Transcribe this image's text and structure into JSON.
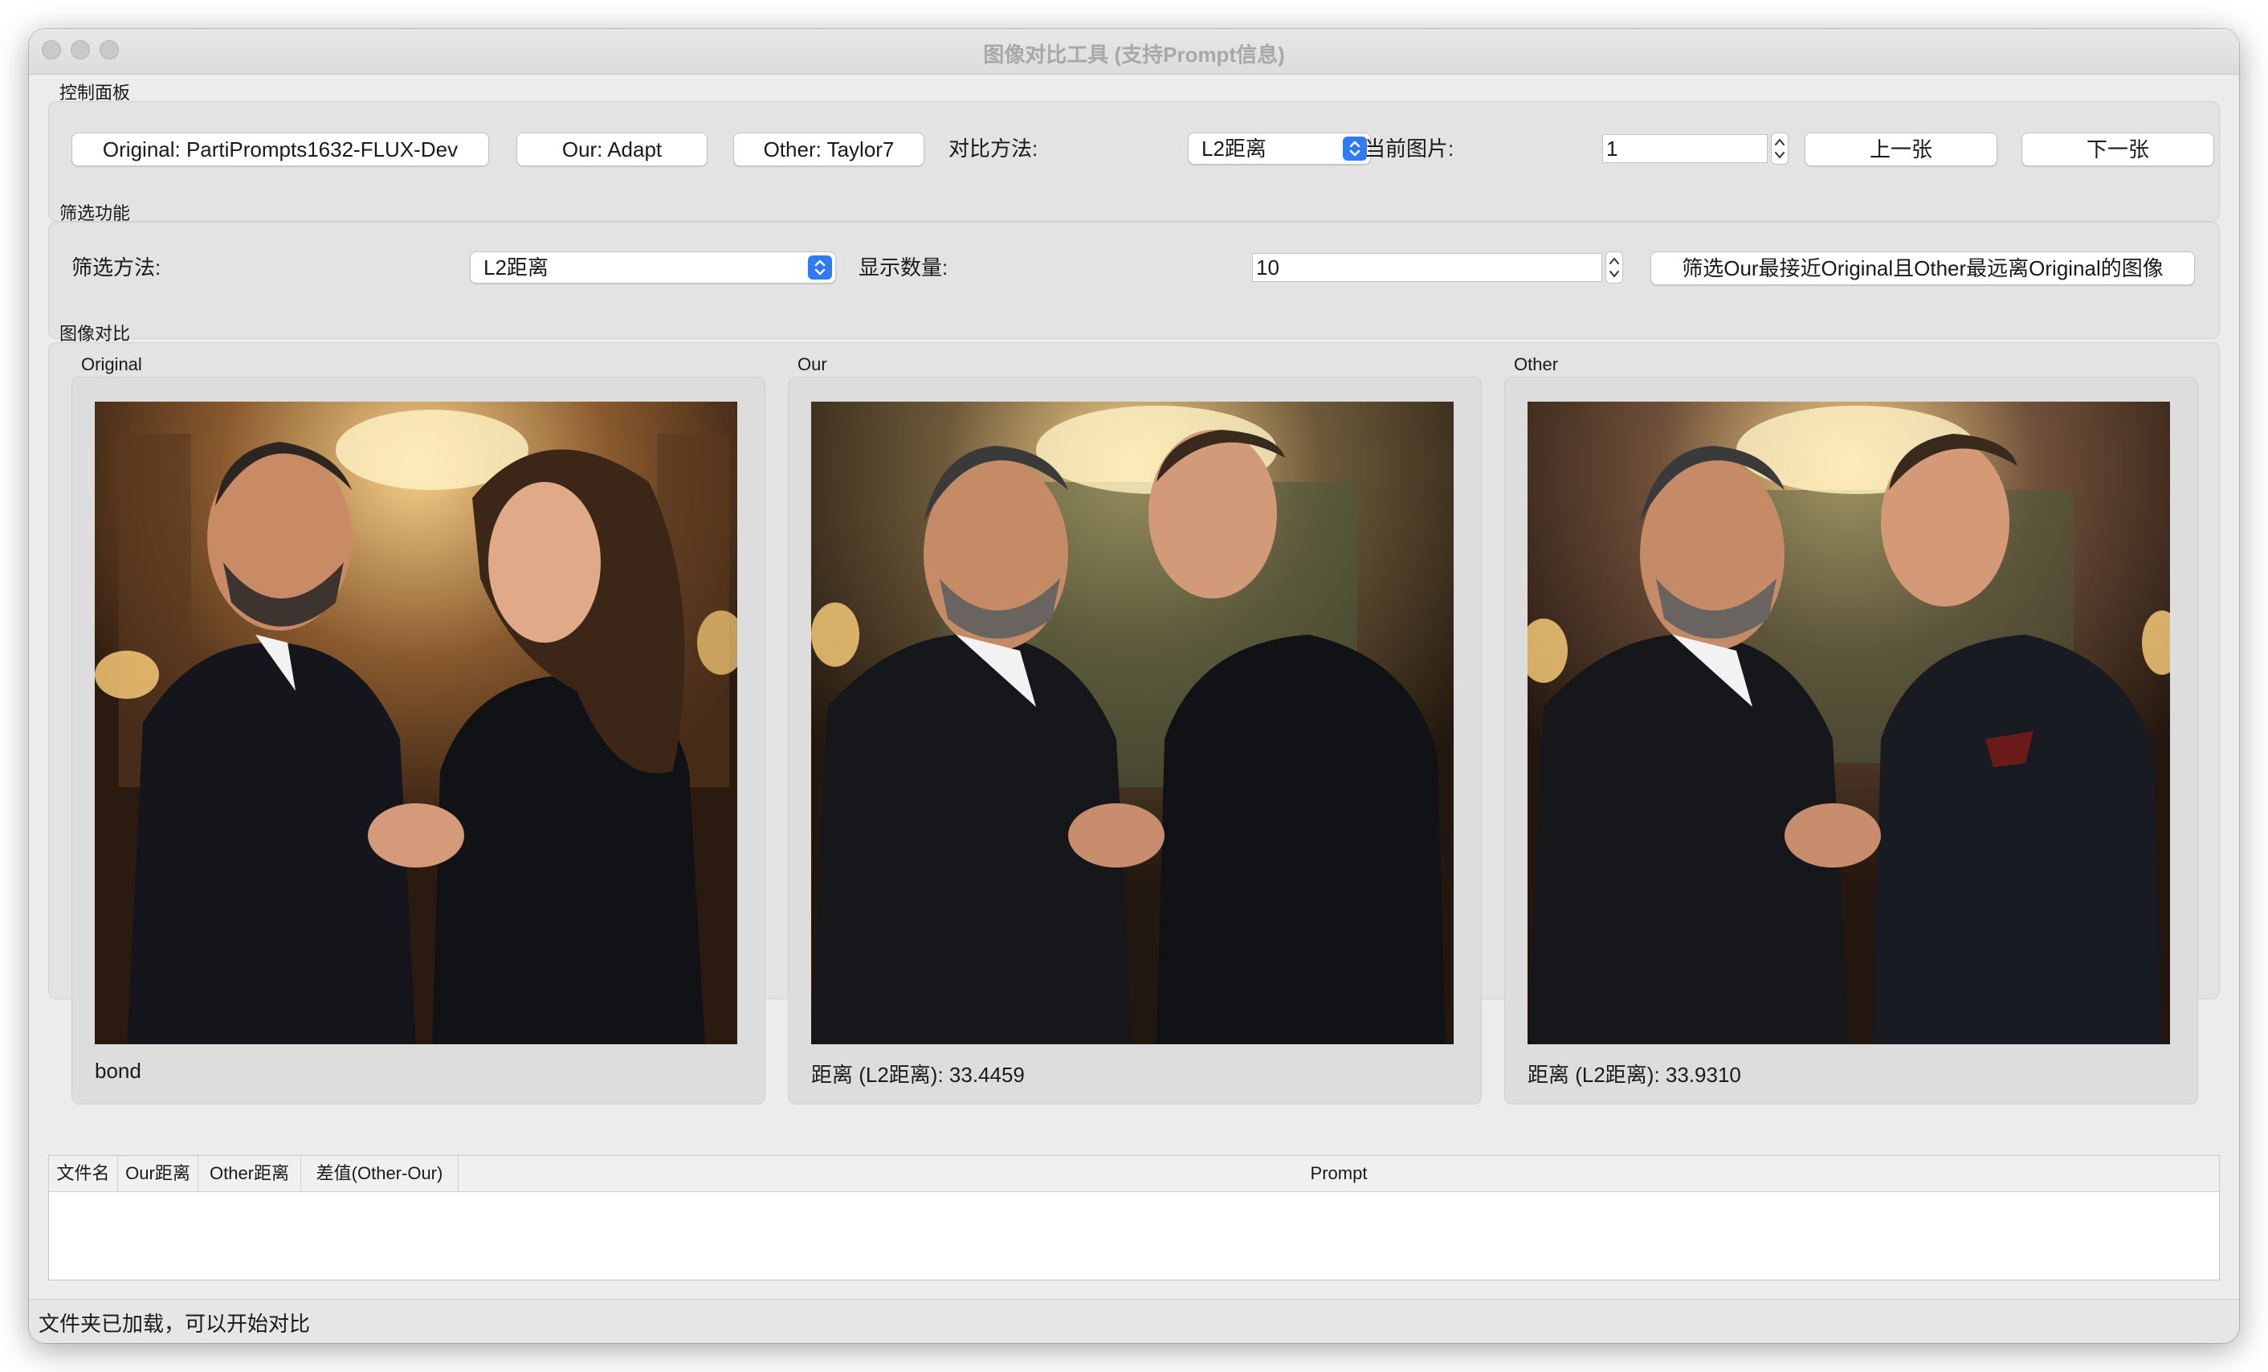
{
  "window": {
    "title": "图像对比工具 (支持Prompt信息)"
  },
  "control_panel": {
    "label": "控制面板",
    "original_button": "Original: PartiPrompts1632-FLUX-Dev",
    "our_button": "Our: Adapt",
    "other_button": "Other: Taylor7",
    "compare_method_label": "对比方法:",
    "compare_method_value": "L2距离",
    "current_image_label": "当前图片:",
    "current_image_value": "1",
    "prev_button": "上一张",
    "next_button": "下一张"
  },
  "filter_panel": {
    "label": "筛选功能",
    "method_label": "筛选方法:",
    "method_value": "L2距离",
    "count_label": "显示数量:",
    "count_value": "10",
    "filter_button": "筛选Our最接近Original且Other最远离Original的图像"
  },
  "compare_panel": {
    "label": "图像对比",
    "images": [
      {
        "label": "Original",
        "caption": "bond"
      },
      {
        "label": "Our",
        "caption": "距离 (L2距离): 33.4459"
      },
      {
        "label": "Other",
        "caption": "距离 (L2距离): 33.9310"
      }
    ]
  },
  "table": {
    "columns": [
      "文件名",
      "Our距离",
      "Other距离",
      "差值(Other-Our)",
      "Prompt"
    ],
    "rows": []
  },
  "status": {
    "text": "文件夹已加载，可以开始对比"
  },
  "colors": {
    "accent": "#2f7bf5",
    "window_bg": "#ececec"
  }
}
